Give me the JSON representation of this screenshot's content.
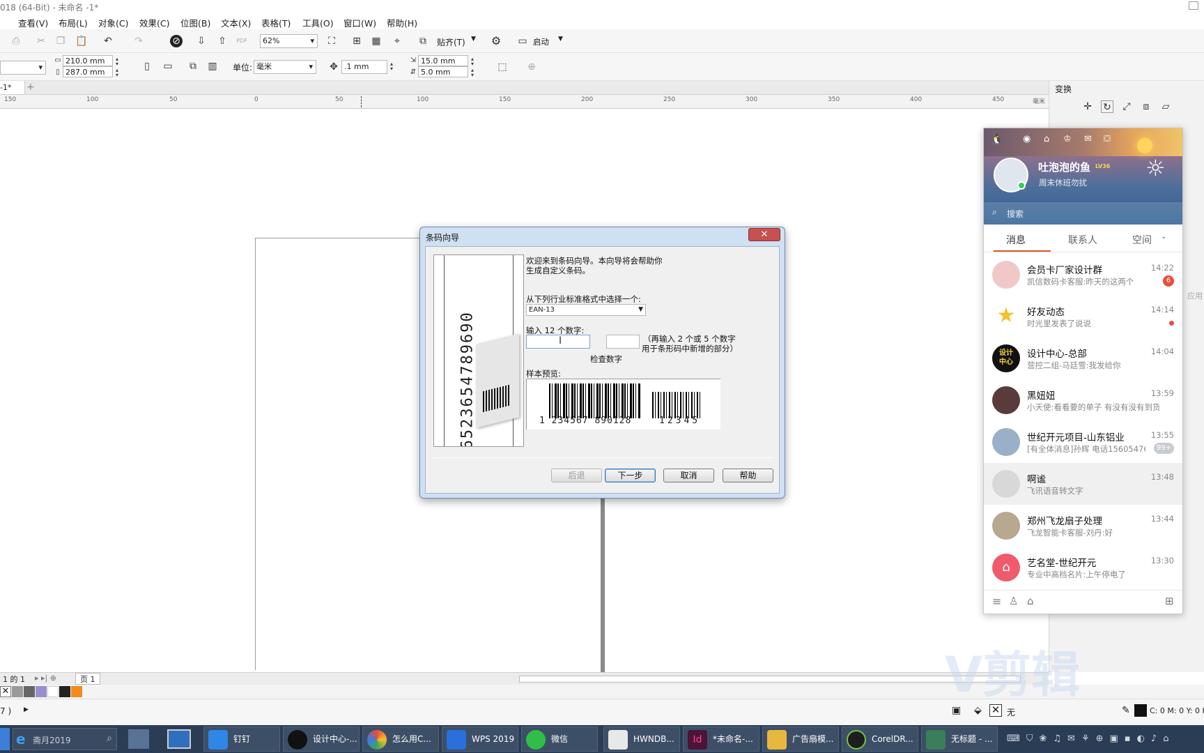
{
  "title_bar": {
    "text": "018 (64-Bit) - 未命名 -1*"
  },
  "menu": [
    "查看(V)",
    "布局(L)",
    "对象(C)",
    "效果(C)",
    "位图(B)",
    "文本(X)",
    "表格(T)",
    "工具(O)",
    "窗口(W)",
    "帮助(H)"
  ],
  "toolbar": {
    "zoom": "62%",
    "snap_label": "贴齐(T)",
    "launch_label": "启动"
  },
  "property_bar": {
    "width": "210.0 mm",
    "height": "287.0 mm",
    "unit_label": "单位:",
    "unit_value": "毫米",
    "nudge": ".1 mm",
    "dup_x": "15.0 mm",
    "dup_y": "5.0 mm"
  },
  "doc_tab": "-1*",
  "ruler_ticks": [
    "150",
    "100",
    "50",
    "0",
    "50",
    "100",
    "150",
    "200",
    "250",
    "300",
    "350",
    "400",
    "450"
  ],
  "ruler_unit": "毫米",
  "docker": {
    "title": "变换",
    "apply_label": "应用"
  },
  "page_nav": {
    "counter": "1 的 1",
    "page_tab": "页 1"
  },
  "status": {
    "left": "7 )",
    "fill_label": "无",
    "color_readout": "C: 0 M: 0 Y: 0 K"
  },
  "dialog": {
    "title": "条码向导",
    "intro_line1": "欢迎来到条码向导。本向导将会帮助你",
    "intro_line2": "生成自定义条码。",
    "format_label": "从下列行业标准格式中选择一个:",
    "format_value": "EAN-13",
    "digits_label": "输入 12 个数字:",
    "extra_line1": "（再输入 2 个或 5 个数字",
    "extra_line2": "用于条形码中新增的部分）",
    "check_label": "检查数字",
    "preview_label": "样本预览:",
    "preview_main_digits": "1 234567 890128",
    "preview_addon_digits": "12345",
    "side_digits": "6523654789690",
    "buttons": {
      "back": "后退",
      "next": "下一步",
      "cancel": "取消",
      "help": "帮助"
    }
  },
  "qq": {
    "nickname": "吐泡泡的鱼",
    "level": "LV36",
    "signature": "周末休班勿扰",
    "search_placeholder": "搜索",
    "tabs": [
      "消息",
      "联系人",
      "空间"
    ],
    "conversations": [
      {
        "name": "会员卡厂家设计群",
        "msg": "凯信数码卡客服:昨天的这两个",
        "time": "14:22",
        "badge": "6",
        "avatar_color": "#f0c8c8"
      },
      {
        "name": "好友动态",
        "msg": "时光里发表了说说",
        "time": "14:14",
        "dot": true,
        "avatar_color": "#f7d13a"
      },
      {
        "name": "设计中心-总部",
        "msg": "营控二组-马廷雪:我发给你",
        "time": "14:04",
        "avatar_color": "#111111",
        "avatar_text": "设计中心"
      },
      {
        "name": "黑妞妞",
        "msg": "小天使:看看要的单子 有没有没有到货",
        "time": "13:59",
        "avatar_color": "#5a3b3b"
      },
      {
        "name": "世纪开元项目-山东铝业",
        "msg": "[有全体消息]孙辉 电话15605476",
        "time": "13:55",
        "badge": "99+",
        "avatar_color": "#9ab0c8"
      },
      {
        "name": "啊谧",
        "msg": "飞讯语音转文字",
        "time": "13:48",
        "selected": true,
        "avatar_color": "#d8d8d8"
      },
      {
        "name": "郑州飞龙扇子处理",
        "msg": "飞龙智能卡客服-刘丹:好",
        "time": "13:44",
        "avatar_color": "#b8a890"
      },
      {
        "name": "艺名堂-世纪开元",
        "msg": "专业中高档名片:上午停电了",
        "time": "13:30",
        "avatar_color": "#ef5b6b"
      }
    ]
  },
  "taskbar": {
    "search_placeholder": "斋月2019",
    "items": [
      {
        "label": "钉钉",
        "color": "#2f86e6"
      },
      {
        "label": "设计中心-...",
        "color": "#111111"
      },
      {
        "label": "怎么用C...",
        "color": "#e44d3a"
      },
      {
        "label": "WPS 2019",
        "color": "#2a6fdb"
      },
      {
        "label": "微信",
        "color": "#2fbf47"
      },
      {
        "label": "HWNDB...",
        "color": "#e8e8e8"
      },
      {
        "label": "*未命名-...",
        "color": "#4b1537"
      },
      {
        "label": "广告扇模...",
        "color": "#e7b83d"
      },
      {
        "label": "CorelDR...",
        "color": "#1e1e1e"
      },
      {
        "label": "无标题 - ...",
        "color": "#3a7f5a"
      }
    ]
  },
  "watermark": "V剪辑"
}
